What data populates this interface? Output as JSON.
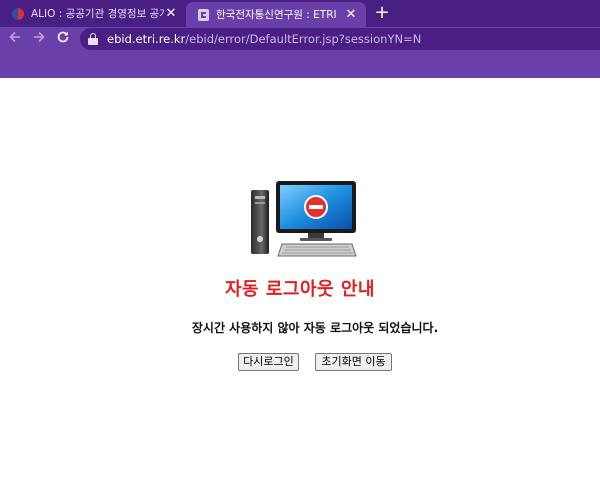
{
  "browser": {
    "tabs": [
      {
        "title": "ALIO : 공공기관 경영정보 공개시",
        "active": false,
        "favicon": "alio-favicon-icon"
      },
      {
        "title": "한국전자통신연구원 : ETRI",
        "active": true,
        "favicon": "etri-favicon-icon"
      }
    ],
    "close_glyph": "✕",
    "new_tab_glyph": "+",
    "url": {
      "host": "ebid.etri.re.kr",
      "path": "/ebid/error/DefaultError.jsp?sessionYN=N"
    },
    "colors": {
      "tabstrip": "#4a1f83",
      "toolbar": "#6a3fa9"
    }
  },
  "page": {
    "illustration": "computer-error-icon",
    "title": "자동 로그아웃 안내",
    "message": "장시간 사용하지 않아 자동 로그아웃 되었습니다.",
    "buttons": {
      "relogin": "다시로그인",
      "home": "초기화면 이동"
    },
    "colors": {
      "title": "#e02020"
    }
  }
}
